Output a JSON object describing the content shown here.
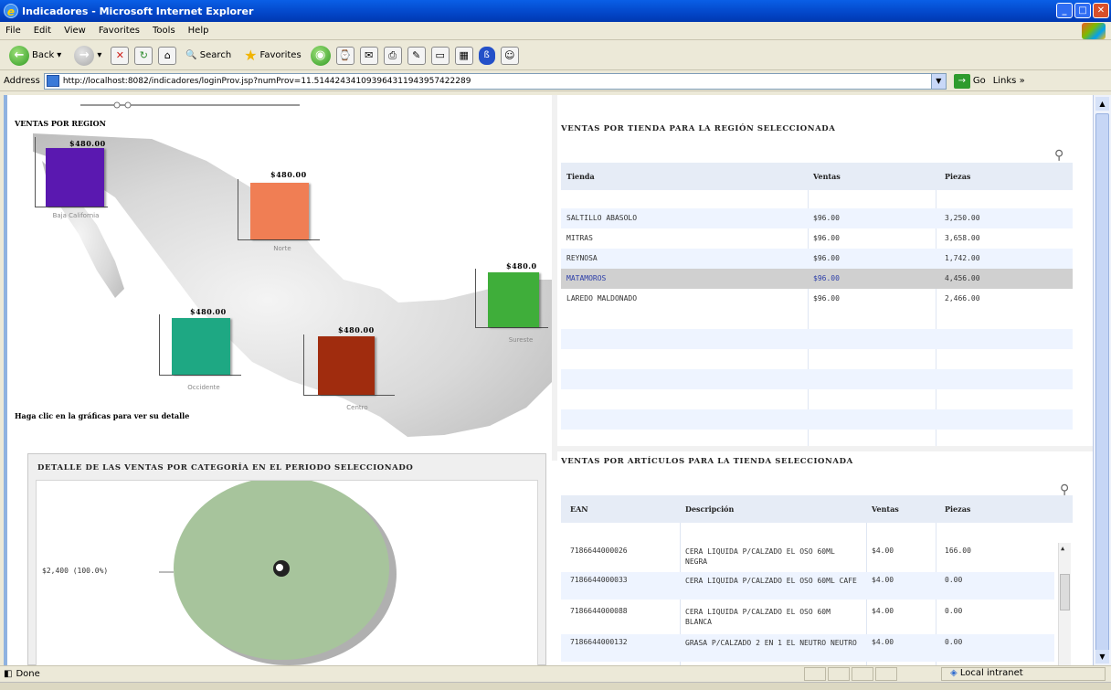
{
  "window": {
    "title": "Indicadores - Microsoft Internet Explorer"
  },
  "menu": [
    "File",
    "Edit",
    "View",
    "Favorites",
    "Tools",
    "Help"
  ],
  "toolbar": {
    "back": "Back",
    "search": "Search",
    "favorites": "Favorites"
  },
  "address": {
    "label": "Address",
    "url": "http://localhost:8082/indicadores/loginProv.jsp?numProv=11.514424341093964311943957422289",
    "go": "Go",
    "links": "Links"
  },
  "status": {
    "left": "Done",
    "zone": "Local intranet"
  },
  "region": {
    "title": "VENTAS POR REGION",
    "hint": "Haga clic en la gráficas para ver su detalle",
    "charts": [
      {
        "value": "$480.00",
        "label": "Baja California",
        "color": "#5a18b0"
      },
      {
        "value": "$480.00",
        "label": "Norte",
        "color": "#f07e54"
      },
      {
        "value": "$480.0",
        "label": "Sureste",
        "color": "#3fae3a"
      },
      {
        "value": "$480.00",
        "label": "Occidente",
        "color": "#1ea883"
      },
      {
        "value": "$480.00",
        "label": "Centro",
        "color": "#a02c0e"
      }
    ]
  },
  "stores": {
    "title": "VENTAS POR TIENDA PARA LA REGIÓN SELECCIONADA",
    "headers": [
      "Tienda",
      "Ventas",
      "Piezas"
    ],
    "rows": [
      [
        "SALTILLO ABASOLO",
        "$96.00",
        "3,250.00"
      ],
      [
        "MITRAS",
        "$96.00",
        "3,658.00"
      ],
      [
        "REYNOSA",
        "$96.00",
        "1,742.00"
      ],
      [
        "MATAMOROS",
        "$96.00",
        "4,456.00"
      ],
      [
        "LAREDO MALDONADO",
        "$96.00",
        "2,466.00"
      ]
    ],
    "selected_row": 3
  },
  "articles": {
    "title": "VENTAS POR ARTÍCULOS PARA LA TIENDA SELECCIONADA",
    "headers": [
      "EAN",
      "Descripción",
      "Ventas",
      "Piezas"
    ],
    "rows": [
      [
        "7186644000026",
        "CERA LIQUIDA P/CALZADO EL OSO 60ML NEGRA",
        "$4.00",
        "166.00"
      ],
      [
        "7186644000033",
        "CERA LIQUIDA P/CALZADO EL OSO 60ML CAFE",
        "$4.00",
        "0.00"
      ],
      [
        "7186644000088",
        "CERA LIQUIDA P/CALZADO EL OSO 60M BLANCA",
        "$4.00",
        "0.00"
      ],
      [
        "7186644000132",
        "GRASA P/CALZADO 2 EN 1 EL NEUTRO NEUTRO",
        "$4.00",
        "0.00"
      ]
    ]
  },
  "detail": {
    "title": "DETALLE DE LAS VENTAS POR CATEGORÍA EN EL PERIODO SELECCIONADO",
    "slice_label": "$2,400 (100.0%)",
    "slice_color": "#a7c49c"
  }
}
